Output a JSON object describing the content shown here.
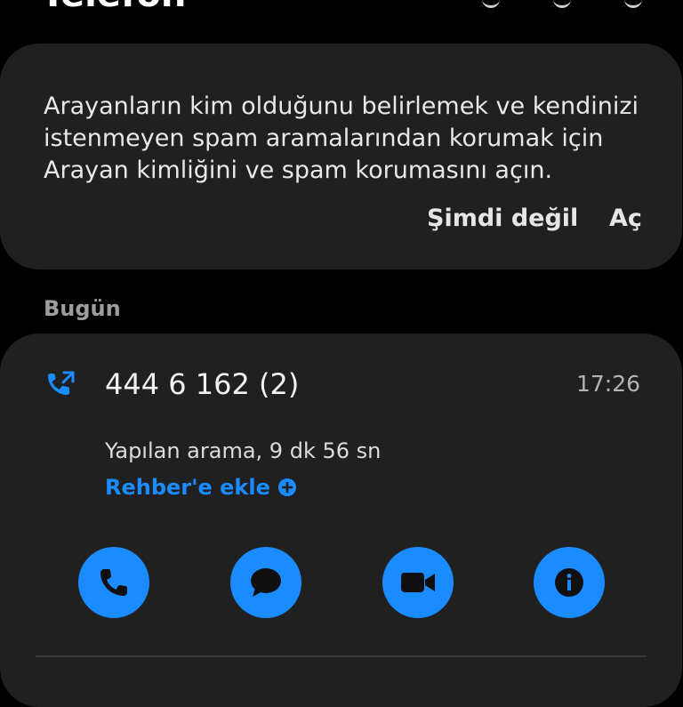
{
  "app": {
    "title": "Telefon"
  },
  "spam_banner": {
    "message": "Arayanların kim olduğunu belirlemek ve kendinizi istenmeyen spam aramalarından korumak için Arayan kimliğini ve spam korumasını açın.",
    "not_now_label": "Şimdi değil",
    "open_label": "Aç"
  },
  "section": {
    "today_label": "Bugün"
  },
  "call_entry": {
    "number": "444 6 162 (2)",
    "time": "17:26",
    "detail": "Yapılan arama, 9 dk 56 sn",
    "add_contact_label": "Rehber'e ekle",
    "type_icon": "outgoing-call-icon"
  },
  "actions": [
    {
      "name": "call",
      "icon": "phone-icon"
    },
    {
      "name": "message",
      "icon": "message-icon"
    },
    {
      "name": "video",
      "icon": "video-icon"
    },
    {
      "name": "info",
      "icon": "info-icon"
    }
  ],
  "colors": {
    "accent": "#1a8cff",
    "background": "#000000",
    "card": "#202020"
  }
}
